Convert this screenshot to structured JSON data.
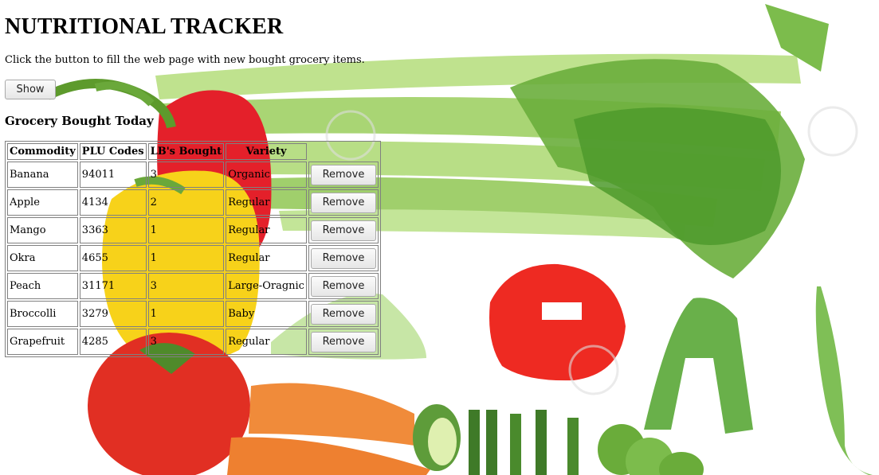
{
  "page": {
    "title": "NUTRITIONAL TRACKER",
    "intro": "Click the button to fill the web page with new bought grocery items.",
    "show_label": "Show",
    "section_heading": "Grocery Bought Today"
  },
  "table": {
    "headers": [
      "Commodity",
      "PLU Codes",
      "LB's Bought",
      "Variety"
    ],
    "remove_label": "Remove",
    "rows": [
      [
        "Banana",
        "94011",
        "3",
        "Organic"
      ],
      [
        "Apple",
        "4134",
        "2",
        "Regular"
      ],
      [
        "Mango",
        "3363",
        "1",
        "Regular"
      ],
      [
        "Okra",
        "4655",
        "1",
        "Regular"
      ],
      [
        "Peach",
        "31171",
        "3",
        "Large-Oragnic"
      ],
      [
        "Broccolli",
        "3279",
        "1",
        "Baby"
      ],
      [
        "Grapefruit",
        "4285",
        "3",
        "Regular"
      ]
    ]
  },
  "background": {
    "image_name": "vegetables-photo",
    "colors": {
      "celery": "#a8d66e",
      "pepper_red": "#e8202a",
      "pepper_yellow": "#f8d61a",
      "tomato": "#e83a2a",
      "carrot": "#f08a3a",
      "cucumber": "#6ab04a"
    }
  }
}
